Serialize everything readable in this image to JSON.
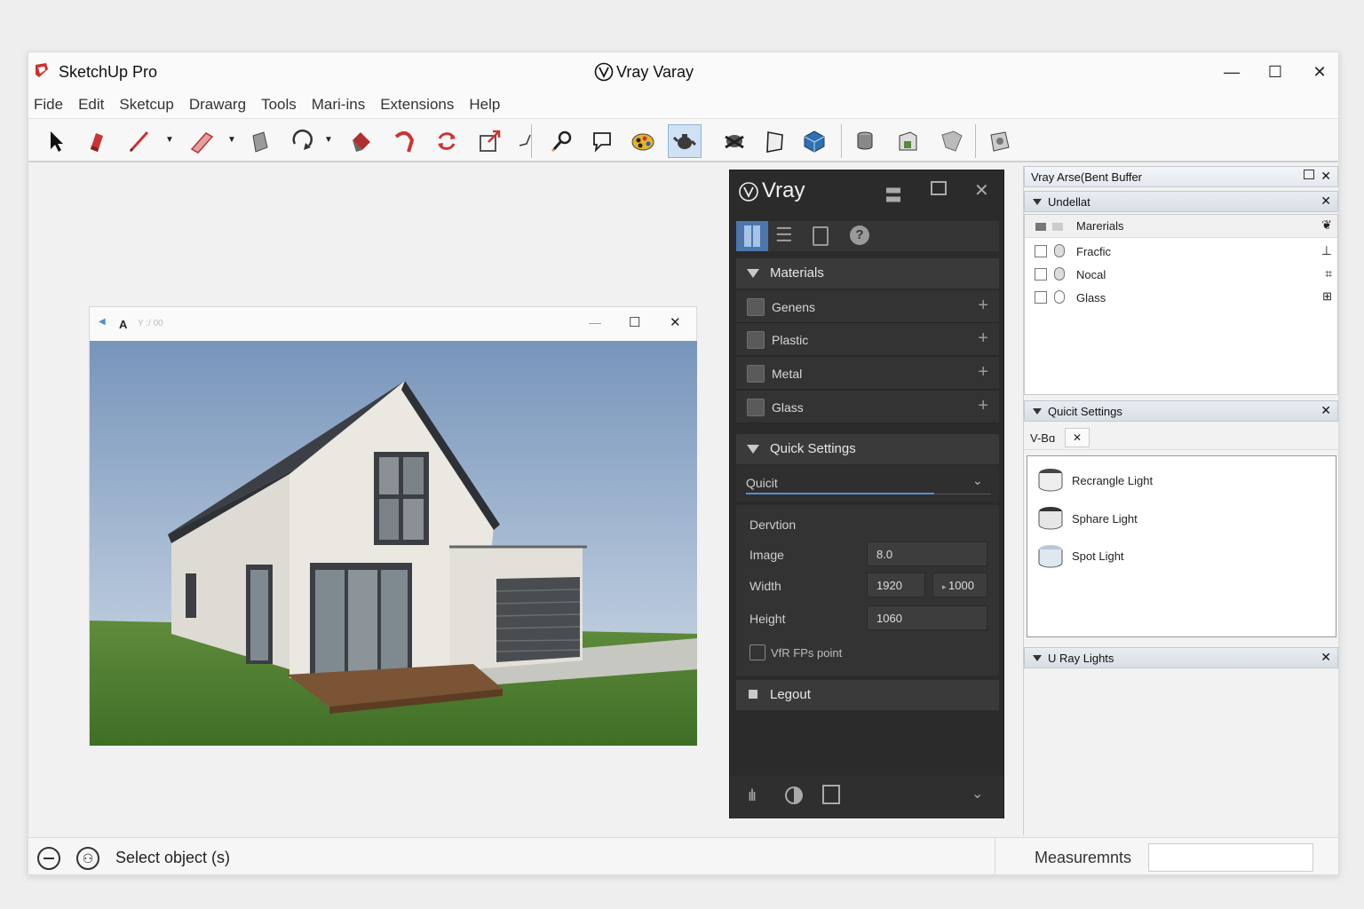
{
  "app": {
    "title": "SketchUp Pro",
    "doc_title": "Vray Varay"
  },
  "window_controls": {
    "minimize": "—",
    "maximize": "☐",
    "close": "✕"
  },
  "menu": [
    "Fide",
    "Edit",
    "Sketcup",
    "Drawarg",
    "Tools",
    "Mari-ins",
    "Extensions",
    "Help"
  ],
  "render_window": {
    "label": "A",
    "sub": "Y :/ 00",
    "min": "—",
    "max": "☐",
    "close": "✕"
  },
  "vray_panel": {
    "title": "Vray",
    "materials_header": "Materials",
    "materials": [
      {
        "name": "Genens"
      },
      {
        "name": "Plastic"
      },
      {
        "name": "Metal"
      },
      {
        "name": "Glass"
      }
    ],
    "plus": "+",
    "quick_header": "Quick Settings",
    "quick_select": "Quicit",
    "dervtion": "Dervtion",
    "image_label": "Image",
    "image_value": "8.0",
    "width_label": "Width",
    "width_value": "1920",
    "width_value2": "1000",
    "height_label": "Height",
    "height_value": "1060",
    "checkbox_label": "VfR FPs point",
    "legout": "Legout"
  },
  "right_panel": {
    "buffer_title": "Vray Arse(Bent Buffer",
    "undellat": "Undellat",
    "materials_label": "Marerials",
    "items": [
      "Fracfic",
      "Nocal",
      "Glass"
    ],
    "quick_settings": "Quicit Settings",
    "tab": "V-Bɑ",
    "lights": [
      "Recrangle Light",
      "Sphare Light",
      "Spot Light"
    ],
    "ray_lights": "U Ray Lights",
    "close": "✕"
  },
  "status": {
    "text": "Select object (s)",
    "measurements": "Measuremnts",
    "measure_value": ""
  },
  "colors": {
    "vray_bg": "#2b2b2b",
    "accent_blue": "#5a8fd0",
    "sky": "#7e9cc0",
    "grass": "#4e7d32"
  }
}
